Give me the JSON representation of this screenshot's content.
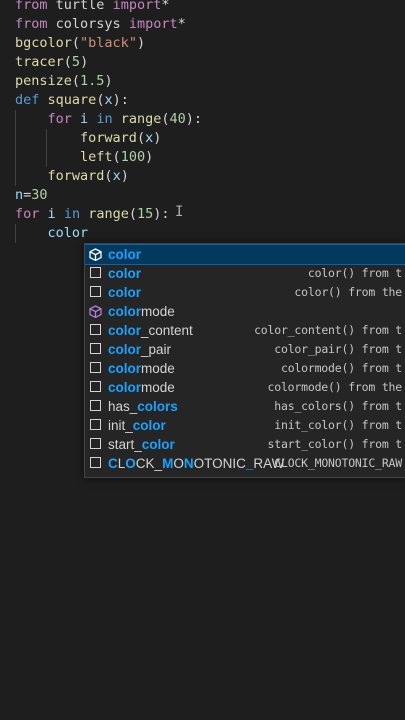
{
  "code_lines": [
    {
      "id": "l1",
      "text": "from turtle import*"
    },
    {
      "id": "l2",
      "text": "from colorsys import*"
    },
    {
      "id": "l3",
      "text": "bgcolor(\"black\")"
    },
    {
      "id": "l4",
      "text": "tracer(5)"
    },
    {
      "id": "l5",
      "text": "pensize(1.5)"
    },
    {
      "id": "l6",
      "text": "def square(x):"
    },
    {
      "id": "l7",
      "text": "    for i in range(40):"
    },
    {
      "id": "l8",
      "text": "        forward(x)"
    },
    {
      "id": "l9",
      "text": "        left(100)"
    },
    {
      "id": "l10",
      "text": "    forward(x)"
    },
    {
      "id": "l11",
      "text": "n=30"
    },
    {
      "id": "l12",
      "text": "for i in range(15):"
    },
    {
      "id": "l13",
      "text": "    color"
    }
  ],
  "suggest": {
    "items": [
      {
        "pre": "",
        "hl": "color",
        "post": "",
        "detail": "",
        "icon": "module-icon",
        "selected": true
      },
      {
        "pre": "",
        "hl": "color",
        "post": "",
        "detail": "color() from t",
        "icon": "text-icon",
        "selected": false
      },
      {
        "pre": "",
        "hl": "color",
        "post": "",
        "detail": "color() from the",
        "icon": "text-icon",
        "selected": false
      },
      {
        "pre": "",
        "hl": "color",
        "post": "mode",
        "detail": "",
        "icon": "module-icon",
        "selected": false
      },
      {
        "pre": "",
        "hl": "color",
        "post": "_content",
        "detail": "color_content() from t",
        "icon": "text-icon",
        "selected": false
      },
      {
        "pre": "",
        "hl": "color",
        "post": "_pair",
        "detail": "color_pair() from t",
        "icon": "text-icon",
        "selected": false
      },
      {
        "pre": "",
        "hl": "color",
        "post": "mode",
        "detail": "colormode() from t",
        "icon": "text-icon",
        "selected": false
      },
      {
        "pre": "",
        "hl": "color",
        "post": "mode",
        "detail": "colormode() from the",
        "icon": "text-icon",
        "selected": false
      },
      {
        "pre": "has_",
        "hl": "colors",
        "post": "",
        "detail": "has_colors() from t",
        "icon": "text-icon",
        "selected": false
      },
      {
        "pre": "init_",
        "hl": "color",
        "post": "",
        "detail": "init_color() from t",
        "icon": "text-icon",
        "selected": false
      },
      {
        "pre": "start_",
        "hl": "color",
        "post": "",
        "detail": "start_color() from t",
        "icon": "text-icon",
        "selected": false
      },
      {
        "pre": "",
        "hl": "CLOCK_MONOTONIC_RAW",
        "post": "",
        "detail": "CLOCK_MONOTONIC_RAW",
        "icon": "text-icon",
        "selected": false,
        "special": true
      }
    ]
  },
  "colors": {
    "background": "#1e1e1e",
    "suggest_bg": "#252526",
    "selected_bg": "#04395e",
    "match_highlight": "#18a3ff"
  }
}
